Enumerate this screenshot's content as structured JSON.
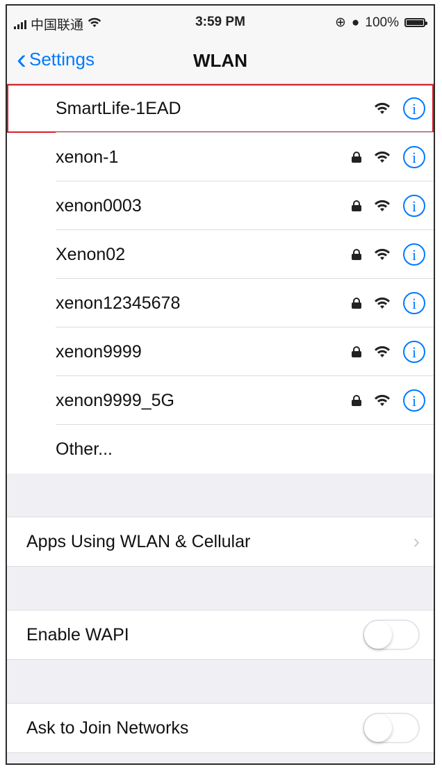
{
  "status_bar": {
    "carrier": "中国联通",
    "time": "3:59 PM",
    "battery": "100%"
  },
  "nav": {
    "back_label": "Settings",
    "title": "WLAN"
  },
  "networks": [
    {
      "name": "SmartLife-1EAD",
      "locked": false,
      "selected": true
    },
    {
      "name": "xenon-1",
      "locked": true,
      "selected": false
    },
    {
      "name": "xenon0003",
      "locked": true,
      "selected": false
    },
    {
      "name": "Xenon02",
      "locked": true,
      "selected": false
    },
    {
      "name": "xenon12345678",
      "locked": true,
      "selected": false
    },
    {
      "name": "xenon9999",
      "locked": true,
      "selected": false
    },
    {
      "name": "xenon9999_5G",
      "locked": true,
      "selected": false
    }
  ],
  "other_label": "Other...",
  "apps_using": {
    "label": "Apps Using WLAN & Cellular"
  },
  "enable_wapi": {
    "label": "Enable WAPI",
    "on": false
  },
  "ask_to_join": {
    "label": "Ask to Join Networks",
    "on": false
  },
  "colors": {
    "accent": "#007aff",
    "highlight": "#d61f2b"
  },
  "icons": {
    "info": "info-icon",
    "lock": "lock-icon",
    "wifi": "wifi-icon",
    "chevron": "chevron-right-icon"
  }
}
